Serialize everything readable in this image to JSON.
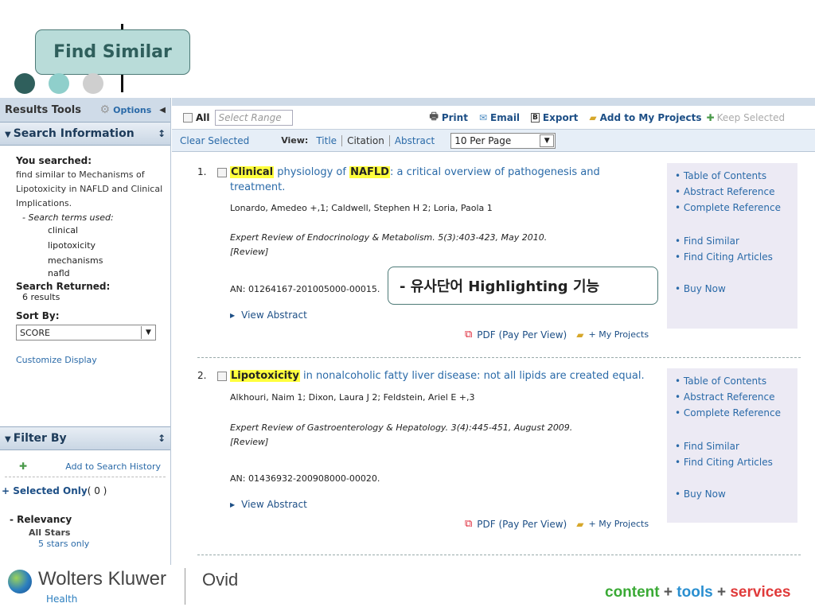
{
  "slide": {
    "title": "Find Similar",
    "callout": "- 유사단어 Highlighting 기능"
  },
  "left_panel": {
    "header": "Results Tools",
    "options_label": "Options",
    "search_info_title": "Search Information",
    "you_searched_label": "You searched:",
    "you_searched_text": "find similar to Mechanisms of Lipotoxicity in NAFLD and Clinical Implications.",
    "search_terms_label": "- Search terms used:",
    "terms": [
      "clinical",
      "lipotoxicity",
      "mechanisms",
      "nafld"
    ],
    "search_returned_label": "Search Returned:",
    "search_returned_value": "6 results",
    "sort_by_label": "Sort By:",
    "sort_value": "SCORE",
    "customize_label": "Customize Display",
    "filter_title": "Filter By",
    "add_history_label": "Add to Search History",
    "selected_only_label": "+ Selected Only",
    "selected_count": "( 0 )",
    "relevancy_label": "- Relevancy",
    "all_stars_label": "All Stars",
    "five_stars_label": "5 stars only"
  },
  "toolbar": {
    "all_label": "All",
    "select_range_placeholder": "Select Range",
    "print_label": "Print",
    "email_label": "Email",
    "export_label": "Export",
    "add_projects_label": "Add to My Projects",
    "keep_selected_label": "Keep Selected"
  },
  "viewbar": {
    "clear_selected": "Clear Selected",
    "view_label": "View:",
    "views": [
      "Title",
      "Citation",
      "Abstract"
    ],
    "per_page": "10 Per Page"
  },
  "results": [
    {
      "num": "1.",
      "title_hl1": "Clinical",
      "title_part1": " physiology of ",
      "title_hl2": "NAFLD",
      "title_part2": ": a critical overview of pathogenesis and treatment.",
      "authors": "Lonardo, Amedeo +,1; Caldwell, Stephen H 2; Loria, Paola 1",
      "source": "Expert Review of Endocrinology & Metabolism. 5(3):403-423, May 2010.",
      "type": "[Review]",
      "an": "AN: 01264167-201005000-00015.",
      "view_abstract": "View Abstract",
      "pdf": "PDF (Pay Per View)",
      "my_projects": "+ My Projects",
      "links": [
        "Table of Contents",
        "Abstract Reference",
        "Complete Reference",
        "Find Similar",
        "Find Citing Articles",
        "Buy Now"
      ]
    },
    {
      "num": "2.",
      "title_hl1": "Lipotoxicity",
      "title_part1": " in nonalcoholic fatty liver disease: not all lipids are created equal.",
      "authors": "Alkhouri, Naim 1; Dixon, Laura J 2; Feldstein, Ariel E +,3",
      "source": "Expert Review of Gastroenterology & Hepatology. 3(4):445-451, August 2009.",
      "type": "[Review]",
      "an": "AN: 01436932-200908000-00020.",
      "view_abstract": "View Abstract",
      "pdf": "PDF (Pay Per View)",
      "my_projects": "+ My Projects",
      "links": [
        "Table of Contents",
        "Abstract Reference",
        "Complete Reference",
        "Find Similar",
        "Find Citing Articles",
        "Buy Now"
      ]
    }
  ],
  "footer": {
    "brand": "Wolters Kluwer",
    "brand_sub": "Health",
    "product": "Ovid",
    "tag_content": "content",
    "plus1": "+",
    "tag_tools": "tools",
    "plus2": "+",
    "tag_services": "services"
  },
  "colors": {
    "dot1": "#2f5f5c",
    "dot2": "#8fcfcb",
    "dot3": "#cfcfcf",
    "highlight": "#ffff3d",
    "content_green": "#3aaa35",
    "tools_blue": "#2a8fd0",
    "services_red": "#e03a3a"
  }
}
